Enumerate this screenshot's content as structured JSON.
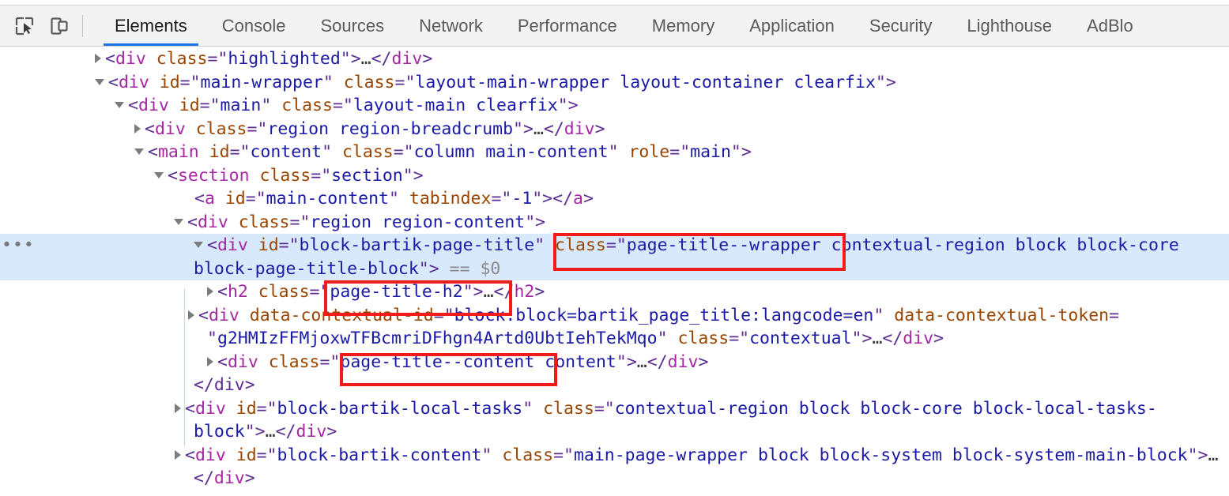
{
  "page_bleed": {
    "text": "* * * * * *"
  },
  "toolbar": {
    "icons": [
      {
        "name": "inspect-element-icon",
        "title": "Inspect element"
      },
      {
        "name": "device-toolbar-icon",
        "title": "Toggle device toolbar"
      }
    ],
    "tabs": [
      {
        "label": "Elements",
        "active": true
      },
      {
        "label": "Console",
        "active": false
      },
      {
        "label": "Sources",
        "active": false
      },
      {
        "label": "Network",
        "active": false
      },
      {
        "label": "Performance",
        "active": false
      },
      {
        "label": "Memory",
        "active": false
      },
      {
        "label": "Application",
        "active": false
      },
      {
        "label": "Security",
        "active": false
      },
      {
        "label": "Lighthouse",
        "active": false
      },
      {
        "label": "AdBlo",
        "active": false
      }
    ],
    "active_tab_underline_color": "#1a73e8"
  },
  "dom_tree": {
    "selected_row_background": "#d7e9fb",
    "annotation_color": "#f21b1b",
    "selected_marker": "== $0",
    "overflow_dots": "•••",
    "rows": {
      "r1_tag": "div",
      "r1_attr": "class",
      "r1_val": "highlighted",
      "r2_tag": "div",
      "r2_attr1": "id",
      "r2_val1": "main-wrapper",
      "r2_attr2": "class",
      "r2_val2": "layout-main-wrapper layout-container clearfix",
      "r3_tag": "div",
      "r3_attr1": "id",
      "r3_val1": "main",
      "r3_attr2": "class",
      "r3_val2": "layout-main clearfix",
      "r4_tag": "div",
      "r4_attr": "class",
      "r4_val": "region region-breadcrumb",
      "r5_tag": "main",
      "r5_attr1": "id",
      "r5_val1": "content",
      "r5_attr2": "class",
      "r5_val2": "column main-content",
      "r5_attr3": "role",
      "r5_val3": "main",
      "r6_tag": "section",
      "r6_attr": "class",
      "r6_val": "section",
      "r7_tag": "a",
      "r7_attr1": "id",
      "r7_val1": "main-content",
      "r7_attr2": "tabindex",
      "r7_val2": "-1",
      "r8_tag": "div",
      "r8_attr": "class",
      "r8_val": "region region-content",
      "r9_tag": "div",
      "r9_attr1": "id",
      "r9_val1": "block-bartik-page-title",
      "r9_attr2": "class",
      "r9_val2_boxed": "page-title--wrapper",
      "r9_val2_rest": " contextual-region block block-core block-page-title-block",
      "r10_tag": "h2",
      "r10_attr": "class",
      "r10_val": "page-title-h2",
      "r11_tag": "div",
      "r11_attr1": "data-contextual-id",
      "r11_val1": "block:block=bartik_page_title:langcode=en",
      "r11_attr2": "data-contextual-token",
      "r11_val2": "g2HMIzFFMjoxwTFBcmriDFhgn4Artd0UbtIehTekMqo",
      "r11_attr3": "class",
      "r11_val3": "contextual",
      "r12_tag": "div",
      "r12_attr": "class",
      "r12_val_boxed": "page-title--content",
      "r12_val_rest": " content",
      "r13_close": "</div>",
      "r14_tag": "div",
      "r14_attr1": "id",
      "r14_val1": "block-bartik-local-tasks",
      "r14_attr2": "class",
      "r14_val2": "contextual-region block block-core block-local-tasks-block",
      "r15_tag": "div",
      "r15_attr1": "id",
      "r15_val1": "block-bartik-content",
      "r15_attr2": "class",
      "r15_val2": "main-page-wrapper block block-system block-system-main-block"
    }
  }
}
